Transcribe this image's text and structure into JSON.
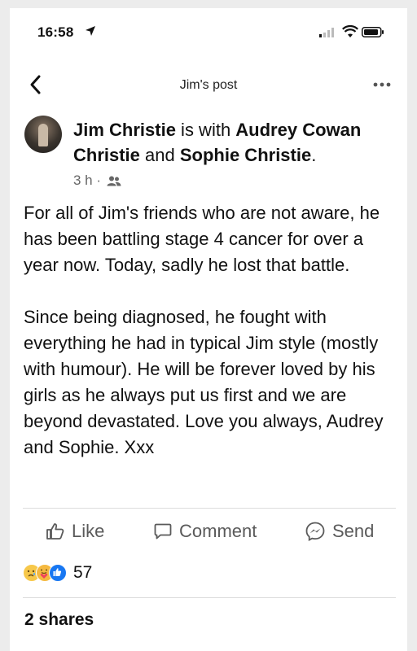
{
  "status_bar": {
    "time": "16:58"
  },
  "nav": {
    "title": "Jim's post"
  },
  "post": {
    "author": "Jim Christie",
    "with_text": " is with ",
    "tagged_1": "Audrey Cowan Christie",
    "and_text": " and ",
    "tagged_2": "Sophie Christie",
    "period": ".",
    "time_ago": "3 h ·",
    "paragraphs": [
      "For all of Jim's friends who are not aware, he has been battling stage 4 cancer for over a year now. Today, sadly he lost that battle.",
      "Since being diagnosed, he fought with everything he had in typical Jim style (mostly with humour). He will be forever loved by his girls as he always put us first and we are beyond devastated. Love you always, Audrey and Sophie. Xxx"
    ]
  },
  "actions": {
    "like": "Like",
    "comment": "Comment",
    "send": "Send"
  },
  "reactions": {
    "count": "57",
    "icons": [
      "sad-reaction-icon",
      "care-reaction-icon",
      "like-reaction-icon"
    ]
  },
  "shares": {
    "label": "2 shares"
  },
  "colors": {
    "like_blue": "#1877f2",
    "secondary_text": "#666666"
  }
}
